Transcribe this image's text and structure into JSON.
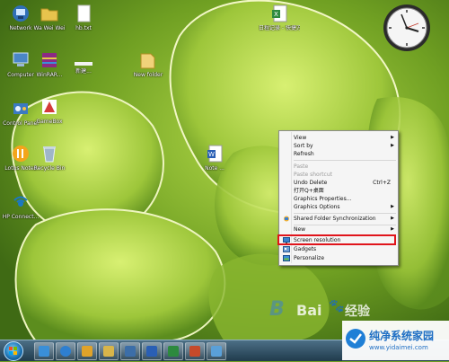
{
  "desktop_icons": [
    {
      "name": "network-icon",
      "label": "Network",
      "color": "#2f6fb7"
    },
    {
      "name": "folder-icon",
      "label": "Wa Wei Wei",
      "color": "#e7c34d"
    },
    {
      "name": "document-icon",
      "label": "hb.txt",
      "color": "#ffffff"
    },
    {
      "name": "computer-icon",
      "label": "Computer",
      "color": "#4a86c6"
    },
    {
      "name": "winrar-icon",
      "label": "WinRAR...",
      "color": "#8c2a84"
    },
    {
      "name": "blank-icon",
      "label": "新建...",
      "color": "#f2f2f2"
    },
    {
      "name": "folder-icon-2",
      "label": "New folder",
      "color": "#e7c34d"
    },
    {
      "name": "control-panel-icon",
      "label": "Control Panel",
      "color": "#3b7ac2"
    },
    {
      "name": "game-icon",
      "label": "GameBox",
      "color": "#d43a3a"
    },
    {
      "name": "lotus-icon",
      "label": "Lotus Notes",
      "color": "#f3a51c"
    },
    {
      "name": "recycle-bin-icon",
      "label": "Recycle Bin",
      "color": "#9fb6c8"
    },
    {
      "name": "hp-connect-icon",
      "label": "HP Connect...",
      "color": "#1b78c4"
    },
    {
      "name": "excel-file-icon",
      "label": "日程记录 - 快捷方式",
      "color": "#2d8a3e"
    },
    {
      "name": "word-file-icon",
      "label": "Note ...",
      "color": "#2a5fb4"
    }
  ],
  "context_menu": {
    "items": [
      {
        "label": "View",
        "shortcut": "",
        "submenu": true,
        "disabled": false
      },
      {
        "label": "Sort by",
        "shortcut": "",
        "submenu": true,
        "disabled": false
      },
      {
        "label": "Refresh",
        "shortcut": "",
        "submenu": false,
        "disabled": false
      },
      {
        "label": "Paste",
        "shortcut": "",
        "submenu": false,
        "disabled": true
      },
      {
        "label": "Paste shortcut",
        "shortcut": "",
        "submenu": false,
        "disabled": true
      },
      {
        "label": "Undo Delete",
        "shortcut": "Ctrl+Z",
        "submenu": false,
        "disabled": false
      },
      {
        "label": "打开Q+桌面",
        "shortcut": "",
        "submenu": false,
        "disabled": false
      },
      {
        "label": "Graphics Properties...",
        "shortcut": "",
        "submenu": false,
        "disabled": false
      },
      {
        "label": "Graphics Options",
        "shortcut": "",
        "submenu": true,
        "disabled": false
      },
      {
        "label": "Shared Folder Synchronization",
        "shortcut": "",
        "submenu": true,
        "disabled": false
      },
      {
        "label": "New",
        "shortcut": "",
        "submenu": true,
        "disabled": false
      },
      {
        "label": "Screen resolution",
        "shortcut": "",
        "submenu": false,
        "disabled": false
      },
      {
        "label": "Gadgets",
        "shortcut": "",
        "submenu": false,
        "disabled": false
      },
      {
        "label": "Personalize",
        "shortcut": "",
        "submenu": false,
        "disabled": false
      }
    ],
    "highlight_color": "#e0141b"
  },
  "watermark": {
    "baidu": "Bai",
    "jingyan": "经验",
    "site_cn": "纯净系统家园",
    "site_url": "www.yidaimei.com"
  },
  "taskbar": {
    "buttons": [
      {
        "name": "media-player-icon",
        "color": "#3a8fd8"
      },
      {
        "name": "ie-icon",
        "color": "#2e7fd0"
      },
      {
        "name": "outlook-icon",
        "color": "#e0a32a"
      },
      {
        "name": "explorer-icon",
        "color": "#d8b54a"
      },
      {
        "name": "window-icon",
        "color": "#3c6ea8"
      },
      {
        "name": "word-icon",
        "color": "#2a5fb4"
      },
      {
        "name": "excel-icon",
        "color": "#2d8a3e"
      },
      {
        "name": "powerpoint-icon",
        "color": "#c64a2a"
      },
      {
        "name": "app-icon",
        "color": "#5aa0d8"
      }
    ]
  }
}
